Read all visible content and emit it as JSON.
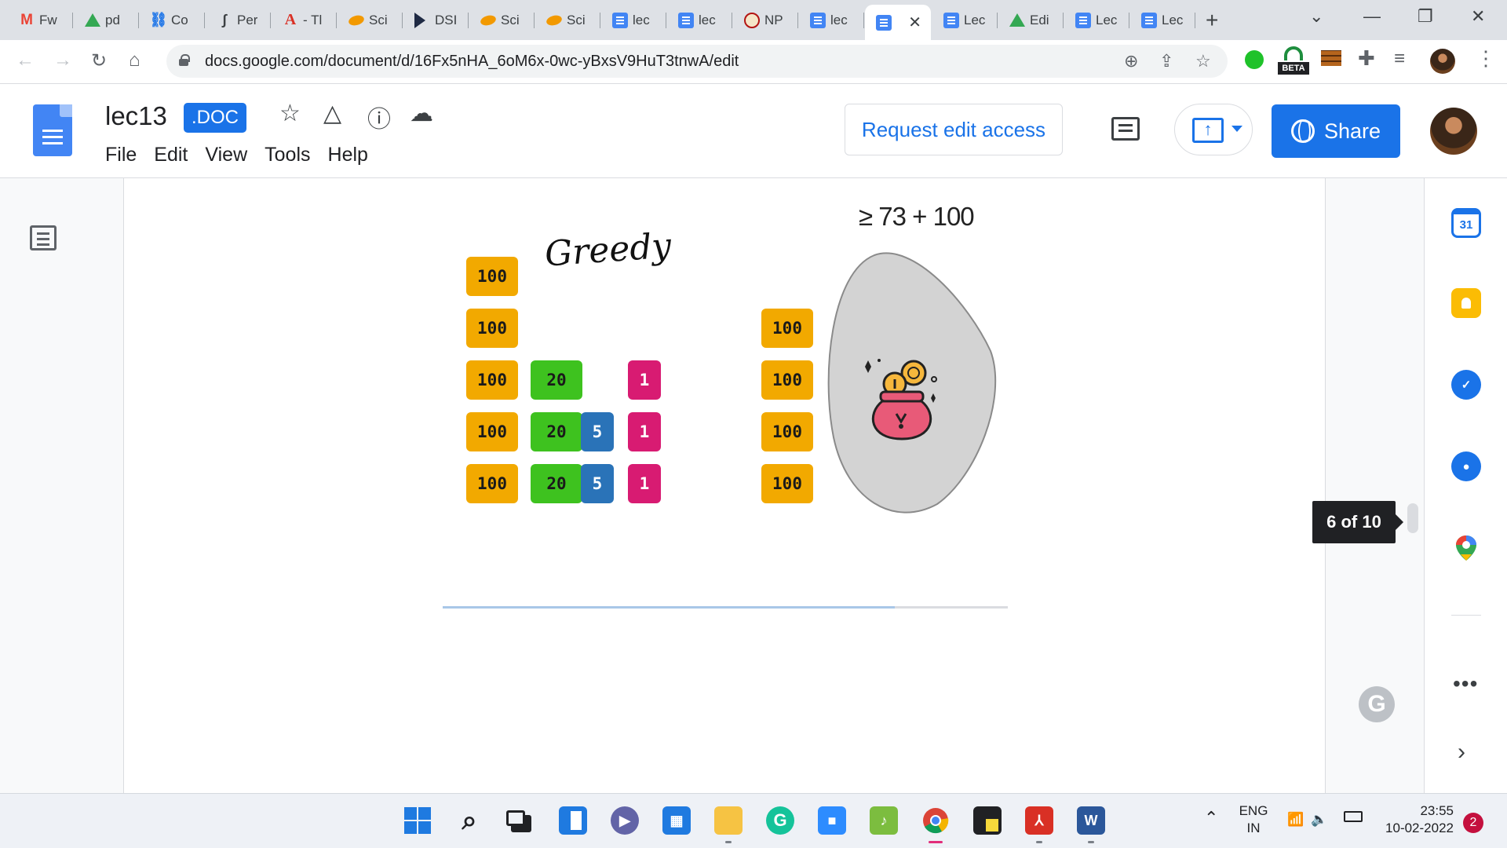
{
  "browser": {
    "tabs": [
      {
        "favicon": "gmail-icon",
        "label": "Fw"
      },
      {
        "favicon": "drive-icon",
        "label": "pd"
      },
      {
        "favicon": "link-icon",
        "label": "Co"
      },
      {
        "favicon": "pen-icon",
        "label": "Per"
      },
      {
        "favicon": "acrobat-icon",
        "label": "- Tl"
      },
      {
        "favicon": "sci-icon",
        "label": "Sci"
      },
      {
        "favicon": "dsi-icon",
        "label": "DSI"
      },
      {
        "favicon": "sci-icon",
        "label": "Sci"
      },
      {
        "favicon": "sci-icon",
        "label": "Sci"
      },
      {
        "favicon": "docs-icon",
        "label": "lec"
      },
      {
        "favicon": "docs-icon",
        "label": "lec"
      },
      {
        "favicon": "nptel-icon",
        "label": "NP"
      },
      {
        "favicon": "docs-icon",
        "label": "lec"
      },
      {
        "favicon": "docs-icon",
        "label": "",
        "active": true
      },
      {
        "favicon": "docs-icon",
        "label": "Lec"
      },
      {
        "favicon": "drive-icon",
        "label": "Edi"
      },
      {
        "favicon": "docs-icon",
        "label": "Lec"
      },
      {
        "favicon": "docs-icon",
        "label": "Lec"
      }
    ],
    "close_glyph": "✕",
    "new_tab_glyph": "+",
    "url": "docs.google.com/document/d/16Fx5nHA_6oM6x-0wc-yBxsV9HuT3tnwA/edit",
    "beta_badge": "BETA"
  },
  "docs": {
    "title": "lec13",
    "badge": ".DOC",
    "menu": [
      "File",
      "Edit",
      "View",
      "Tools",
      "Help"
    ],
    "request_edit_label": "Request edit access",
    "share_label": "Share",
    "accent_color": "#1a73e8"
  },
  "figure": {
    "greedy_label": "Greedy",
    "bound_label": "≥ 73 + 100",
    "greedy_coins": [
      {
        "value": "100",
        "color": "#f2a900"
      },
      {
        "value": "100",
        "color": "#f2a900"
      },
      {
        "value": "100",
        "color": "#f2a900"
      },
      {
        "value": "20",
        "color": "#3ec21f"
      },
      {
        "value": "1",
        "color": "#d81b72"
      },
      {
        "value": "100",
        "color": "#f2a900"
      },
      {
        "value": "20",
        "color": "#3ec21f"
      },
      {
        "value": "5",
        "color": "#2a73b8"
      },
      {
        "value": "1",
        "color": "#d81b72"
      },
      {
        "value": "100",
        "color": "#f2a900"
      },
      {
        "value": "20",
        "color": "#3ec21f"
      },
      {
        "value": "5",
        "color": "#2a73b8"
      },
      {
        "value": "1",
        "color": "#d81b72"
      }
    ],
    "optimal_coins": [
      "100",
      "100",
      "100",
      "100"
    ]
  },
  "page_indicator": "6 of 10",
  "taskbar": {
    "language": "ENG",
    "region": "IN",
    "time": "23:55",
    "date": "10-02-2022",
    "notification_count": "2"
  }
}
